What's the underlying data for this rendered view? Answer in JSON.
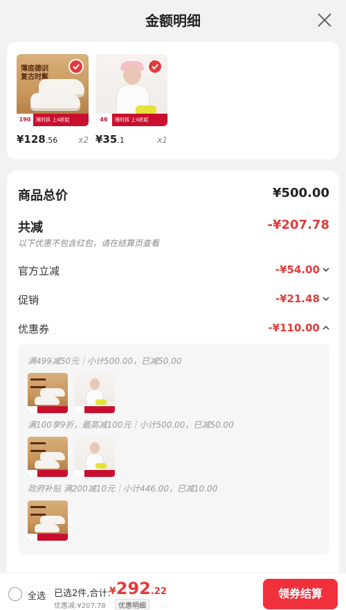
{
  "header": {
    "title": "金额明细"
  },
  "products": [
    {
      "price_int": "¥128",
      "price_dec": ".56",
      "qty": "x2",
      "overlay": "薄底德训复古时髦",
      "tag": "190",
      "promo": "限时拆 上4折起"
    },
    {
      "price_int": "¥35",
      "price_dec": ".1",
      "qty": "x1",
      "tag": "46",
      "promo": "限时拆 上4折起"
    }
  ],
  "summary": {
    "total_label": "商品总价",
    "total_amount": "¥500.00",
    "reduce_label": "共减",
    "reduce_amount": "-¥207.78",
    "reduce_note": "以下优惠不包含红包，请在结算页查看",
    "official_label": "官方立减",
    "official_amount": "-¥54.00",
    "promo_label": "促销",
    "promo_amount": "-¥21.48",
    "coupon_label": "优惠券",
    "coupon_amount": "-¥110.00"
  },
  "coupons": [
    {
      "text": "满499减50元｜小计500.00，已减50.00"
    },
    {
      "text": "满100享9折，最高减100元｜小计500.00，已减50.00"
    },
    {
      "text": "政府补贴 满200减10元｜小计446.00，已减10.00"
    }
  ],
  "bottom": {
    "select_all": "全选",
    "selected": "已选2件,合计:",
    "currency": "¥",
    "total_int": "292",
    "total_dec": ".22",
    "saved": "优惠减:¥207.78",
    "detail_tag": "优惠明细",
    "checkout": "领券结算"
  },
  "colors": {
    "accent": "#f0313c",
    "discount": "#e33a3a"
  }
}
